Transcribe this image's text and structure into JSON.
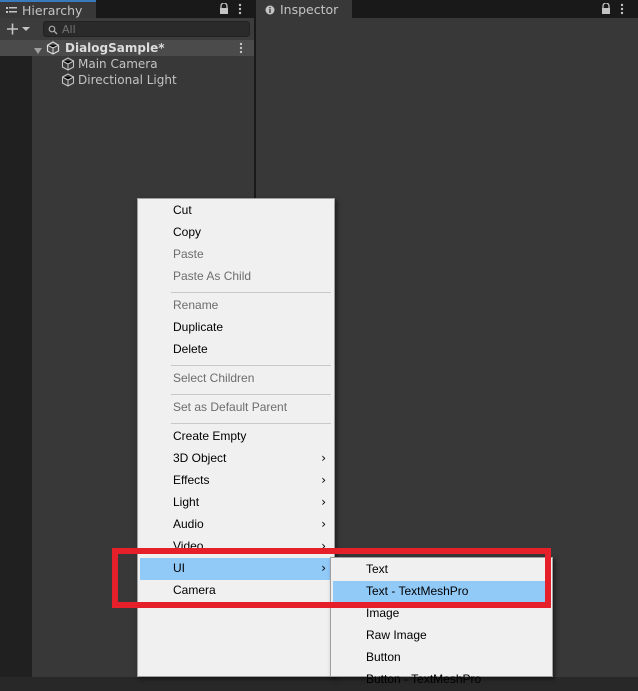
{
  "hierarchy": {
    "tab_label": "Hierarchy",
    "search_placeholder": "All",
    "scene_name": "DialogSample*",
    "items": [
      "Main Camera",
      "Directional Light"
    ]
  },
  "inspector": {
    "tab_label": "Inspector"
  },
  "context_menu": {
    "items": [
      {
        "label": "Cut",
        "state": "enabled"
      },
      {
        "label": "Copy",
        "state": "enabled"
      },
      {
        "label": "Paste",
        "state": "disabled"
      },
      {
        "label": "Paste As Child",
        "state": "disabled"
      },
      {
        "label": "Rename",
        "state": "disabled"
      },
      {
        "label": "Duplicate",
        "state": "enabled"
      },
      {
        "label": "Delete",
        "state": "enabled"
      },
      {
        "label": "Select Children",
        "state": "disabled"
      },
      {
        "label": "Set as Default Parent",
        "state": "disabled"
      },
      {
        "label": "Create Empty",
        "state": "enabled"
      },
      {
        "label": "3D Object",
        "state": "submenu"
      },
      {
        "label": "Effects",
        "state": "submenu"
      },
      {
        "label": "Light",
        "state": "submenu"
      },
      {
        "label": "Audio",
        "state": "submenu"
      },
      {
        "label": "Video",
        "state": "submenu"
      },
      {
        "label": "UI",
        "state": "submenu-highlighted"
      },
      {
        "label": "Camera",
        "state": "enabled"
      }
    ]
  },
  "ui_submenu": {
    "items": [
      {
        "label": "Text",
        "state": "enabled"
      },
      {
        "label": "Text - TextMeshPro",
        "state": "highlighted"
      },
      {
        "label": "Image",
        "state": "enabled"
      },
      {
        "label": "Raw Image",
        "state": "enabled"
      },
      {
        "label": "Button",
        "state": "enabled"
      },
      {
        "label": "Button - TextMeshPro",
        "state": "enabled"
      }
    ]
  },
  "colors": {
    "highlight_box": "#e5202a",
    "menu_highlight": "#91c9f7",
    "menu_bg": "#f0f0f0",
    "tab_accent": "#3a79bb"
  }
}
